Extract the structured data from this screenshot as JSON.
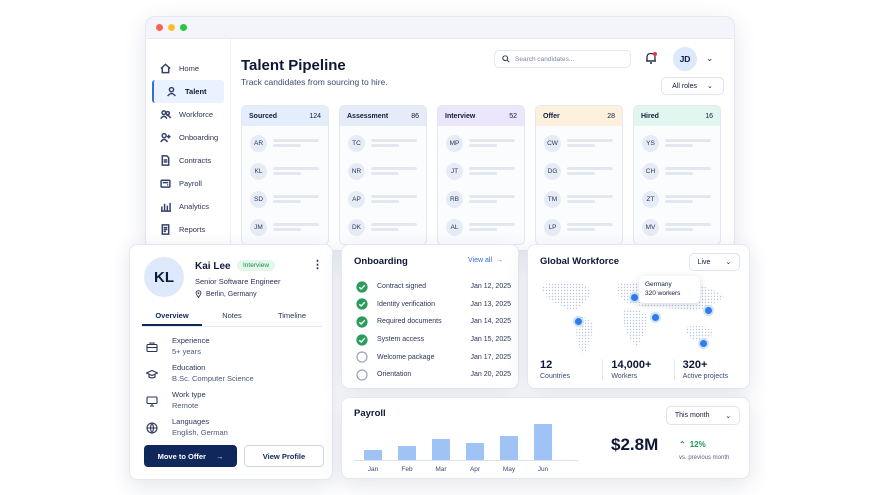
{
  "window": {
    "dots": [
      "#ff5f57",
      "#febc2e",
      "#28c840"
    ]
  },
  "sidebar": {
    "items": [
      {
        "label": "Home",
        "icon": "home-icon"
      },
      {
        "label": "Talent",
        "icon": "person-icon",
        "active": true
      },
      {
        "label": "Workforce",
        "icon": "users-icon"
      },
      {
        "label": "Onboarding",
        "icon": "user-plus-icon"
      },
      {
        "label": "Contracts",
        "icon": "document-icon"
      },
      {
        "label": "Payroll",
        "icon": "wallet-icon"
      },
      {
        "label": "Analytics",
        "icon": "bar-chart-icon"
      },
      {
        "label": "Reports",
        "icon": "report-icon"
      }
    ]
  },
  "header": {
    "title": "Talent Pipeline",
    "subtitle": "Track candidates from sourcing to hire.",
    "search_placeholder": "Search candidates...",
    "avatar": "JD",
    "filter": "All roles"
  },
  "pipeline": [
    {
      "name": "Sourced",
      "count": "124",
      "color": "#e3edfc",
      "candidates": [
        "AR",
        "KL",
        "SD",
        "JM"
      ]
    },
    {
      "name": "Assessment",
      "count": "86",
      "color": "#e5ecf8",
      "candidates": [
        "TC",
        "NR",
        "AP",
        "DK"
      ]
    },
    {
      "name": "Interview",
      "count": "52",
      "color": "#ebe6fb",
      "candidates": [
        "MP",
        "JT",
        "RB",
        "AL"
      ]
    },
    {
      "name": "Offer",
      "count": "28",
      "color": "#fdf0dc",
      "candidates": [
        "CW",
        "DG",
        "TM",
        "LP"
      ]
    },
    {
      "name": "Hired",
      "count": "16",
      "color": "#e0f6ee",
      "candidates": [
        "YS",
        "CH",
        "ZT",
        "MV"
      ]
    }
  ],
  "profile": {
    "initials": "KL",
    "name": "Kai Lee",
    "badge": "Interview",
    "title": "Senior Software Engineer",
    "location": "Berlin, Germany",
    "tabs": [
      "Overview",
      "Notes",
      "Timeline"
    ],
    "details": [
      {
        "label": "Experience",
        "value": "5+ years",
        "icon": "briefcase-icon"
      },
      {
        "label": "Education",
        "value": "B.Sc. Computer Science",
        "icon": "graduation-cap-icon"
      },
      {
        "label": "Work type",
        "value": "Remote",
        "icon": "monitor-icon"
      },
      {
        "label": "Languages",
        "value": "English, German",
        "icon": "globe-icon"
      }
    ],
    "primary_btn": "Move to Offer",
    "secondary_btn": "View Profile"
  },
  "onboarding": {
    "title": "Onboarding",
    "view_all": "View all",
    "tasks": [
      {
        "label": "Contract signed",
        "date": "Jan 12, 2025",
        "done": true
      },
      {
        "label": "Identity verification",
        "date": "Jan 13, 2025",
        "done": true
      },
      {
        "label": "Required documents",
        "date": "Jan 14, 2025",
        "done": true
      },
      {
        "label": "System access",
        "date": "Jan 15, 2025",
        "done": true
      },
      {
        "label": "Welcome package",
        "date": "Jan 17, 2025",
        "done": false
      },
      {
        "label": "Orientation",
        "date": "Jan 20, 2025",
        "done": false
      }
    ]
  },
  "workforce": {
    "title": "Global Workforce",
    "select": "Live",
    "tooltip_country": "Germany",
    "tooltip_value": "320 workers",
    "stats": [
      {
        "value": "12",
        "label": "Countries"
      },
      {
        "value": "14,000+",
        "label": "Workers"
      },
      {
        "value": "320+",
        "label": "Active projects"
      }
    ]
  },
  "payroll": {
    "title": "Payroll",
    "select": "This month",
    "total": "$2.8M",
    "change": "12%",
    "change_label": "vs. previous month"
  },
  "chart_data": {
    "type": "bar",
    "categories": [
      "Jan",
      "Feb",
      "Mar",
      "Apr",
      "May",
      "Jun"
    ],
    "values": [
      1.0,
      1.4,
      2.1,
      1.7,
      2.4,
      3.6
    ],
    "title": "",
    "xlabel": "",
    "ylabel": "",
    "ylim": [
      0,
      4
    ],
    "color": "#9fc3f5"
  }
}
